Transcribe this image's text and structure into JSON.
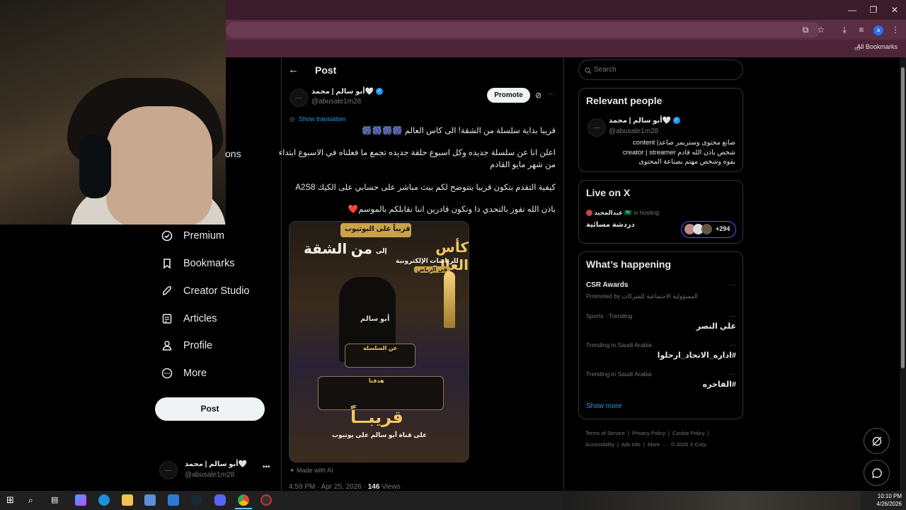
{
  "browser": {
    "bookmarks_label": "All Bookmarks",
    "profile_initial": "a"
  },
  "sidebar": {
    "partial_label": "ons",
    "items": [
      {
        "label": "Premium",
        "icon": "verified-badge-icon"
      },
      {
        "label": "Bookmarks",
        "icon": "bookmark-icon"
      },
      {
        "label": "Creator Studio",
        "icon": "rocket-icon"
      },
      {
        "label": "Articles",
        "icon": "articles-icon"
      },
      {
        "label": "Profile",
        "icon": "person-icon"
      },
      {
        "label": "More",
        "icon": "more-circle-icon"
      }
    ],
    "post_button": "Post",
    "account": {
      "name": "أبو سالم | محمد🤍",
      "handle": "@abusale1m28"
    }
  },
  "post": {
    "header_title": "Post",
    "author_name": "أبو سالم | محمد🤍",
    "author_handle": "@abusale1m28",
    "promote_label": "Promote",
    "show_translation": "Show translation",
    "lines": [
      "قريبا بداية سلسلة من الشقة! الى كاس العالم 🎆🎆🎆🎆",
      "!",
      "اعلن انا عن سلسلة جديده وكل اسبوع حلقة جديده تجمع ما فعلناه في الاسبوع ابتداء",
      "من شهر مايو القادم",
      "كيفية التقدم بتكون قريبا بتتوضح لكم ببث مباشر على حسابي على الكيك A2S8",
      "باذن الله نفوز بالتحدي ذا ونكون قادرين اننا نقابلكم بالموسم❤️"
    ],
    "image": {
      "top_banner": "قريباً على اليوتيوب",
      "title_right": "كأس العالم",
      "title_mid": "إلى",
      "title_left": "من الشقة",
      "subtitle": "للرياضات الإلكترونية",
      "subtitle2": "في الرياض",
      "series_label": "عن السلسلة",
      "goal_label": "هدفنا",
      "soon": "قريبــاً",
      "channel": "على قناة أبو سالم على يوتيوب",
      "name_tag": "أبو سالم"
    },
    "made_with_ai": "Made with AI",
    "timestamp": "4:59 PM · Apr 25, 2026 ·",
    "views_count": "146",
    "views_label": "Views"
  },
  "right": {
    "search_placeholder": "Search",
    "relevant_title": "Relevant people",
    "relevant_person": {
      "name": "أبو سالم | محمد🤍",
      "handle": "@abusale1m28",
      "bio1": "صانع محتوى وستريمر صاعد| content",
      "bio2": "creator | streamer شخص باذن الله قادم",
      "bio3": "بقوه وشخص مهتم بصناعة المحتوى"
    },
    "live_title": "Live on X",
    "live_host": "عبدالمجيد 🇸🇦",
    "live_is_hosting": "is hosting",
    "live_space": "دردشة مسائية",
    "live_count": "+294",
    "happening_title": "What’s happening",
    "trends": [
      {
        "meta": "Promoted by المسؤولية الاجتماعية للشركات",
        "name": "CSR Awards",
        "promoted": true
      },
      {
        "meta": "Sports · Trending",
        "name": "علي النصر"
      },
      {
        "meta": "Trending in Saudi Arabia",
        "name": "#اداره_الاتحاد_ارحلوا"
      },
      {
        "meta": "Trending in Saudi Arabia",
        "name": "#الفاخره"
      }
    ],
    "show_more": "Show more",
    "footer": {
      "l1": "Terms of Service",
      "l2": "Privacy Policy",
      "l3": "Cookie Policy",
      "l4": "Accessibility",
      "l5": "Ads info",
      "l6": "More ···",
      "l7": "© 2026 X Corp."
    }
  },
  "taskbar": {
    "time": "10:10 PM",
    "date": "4/26/2026"
  },
  "colors": {
    "accent": "#1d9bf0",
    "chrome_top": "#3b1c2a",
    "background": "#000000"
  }
}
